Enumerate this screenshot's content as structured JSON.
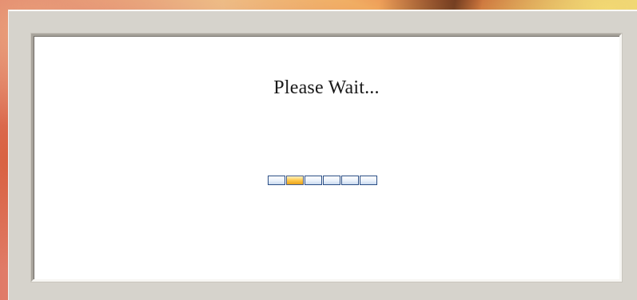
{
  "dialog": {
    "message": "Please Wait..."
  },
  "progress": {
    "segment_count": 6,
    "active_index": 1,
    "active_color": "#ffc84a",
    "inactive_color": "#eaf1fb",
    "border_color": "#2c4f86"
  }
}
